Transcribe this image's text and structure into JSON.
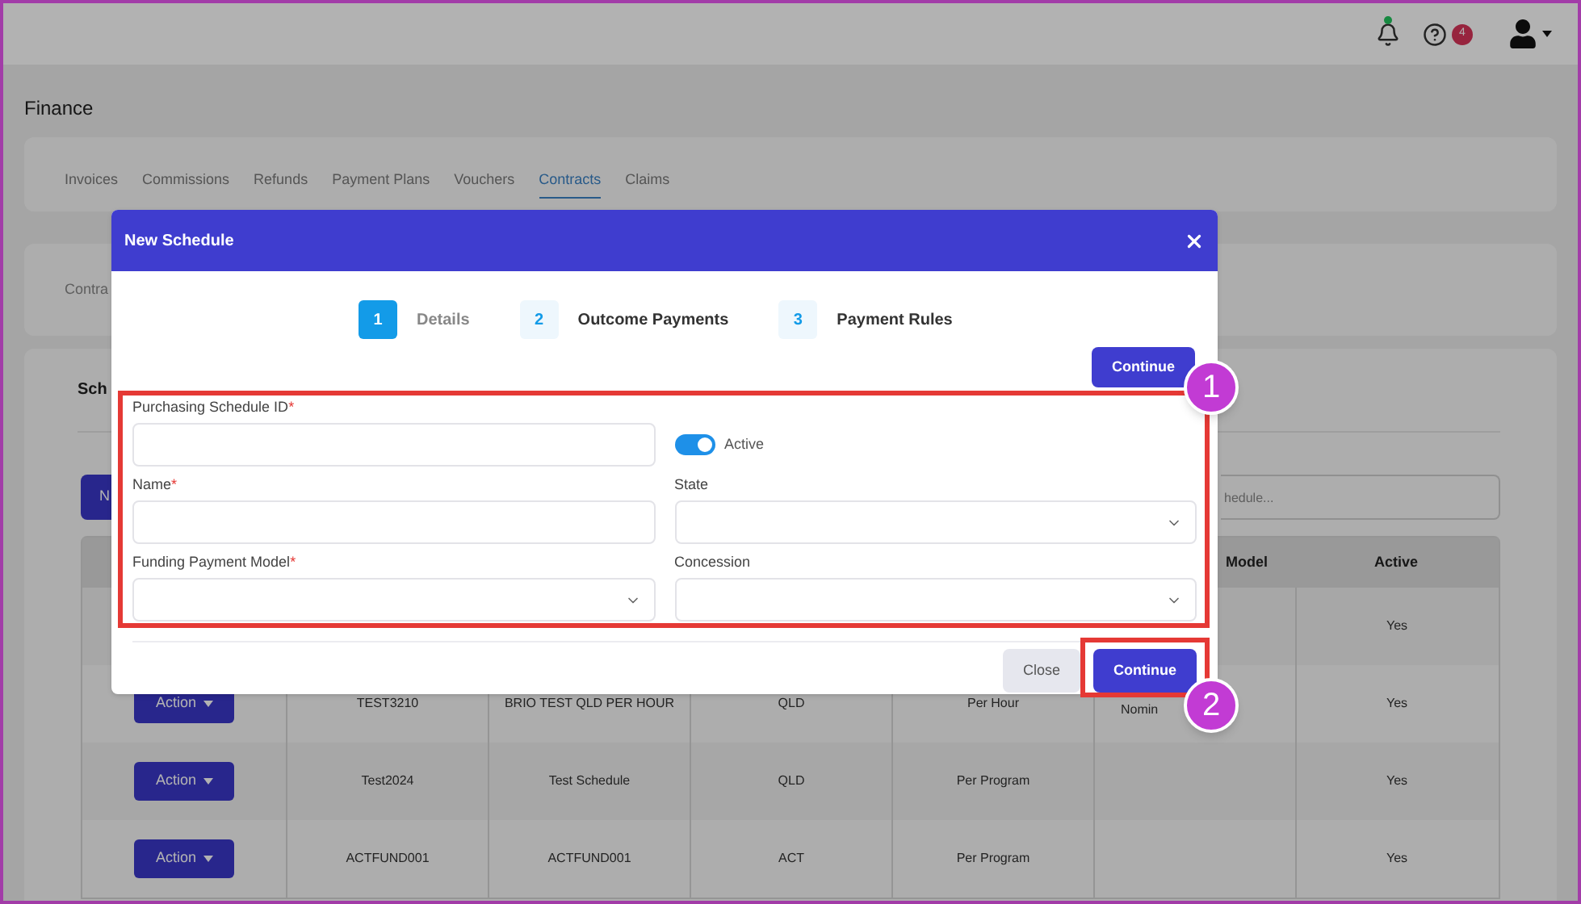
{
  "header": {
    "help_badge": "4"
  },
  "page_title": "Finance",
  "tabs": [
    {
      "label": "Invoices",
      "selected": false
    },
    {
      "label": "Commissions",
      "selected": false
    },
    {
      "label": "Refunds",
      "selected": false
    },
    {
      "label": "Payment Plans",
      "selected": false
    },
    {
      "label": "Vouchers",
      "selected": false
    },
    {
      "label": "Contracts",
      "selected": true
    },
    {
      "label": "Claims",
      "selected": false
    }
  ],
  "contracts_card": {
    "label": "Contra"
  },
  "schedules_card": {
    "title": "Sch",
    "new_button": "N",
    "search": {
      "placeholder": "hedule..."
    },
    "table": {
      "columns": [
        "Model",
        "Active"
      ],
      "rows": [
        {
          "column_7": "Yes"
        },
        {
          "action": "Action",
          "column_2": "TEST3210",
          "column_3": "BRIO TEST QLD PER HOUR",
          "column_4": "QLD",
          "column_5": "Per Hour",
          "column_6": "Nomin",
          "column_7": "Yes"
        },
        {
          "action": "Action",
          "column_2": "Test2024",
          "column_3": "Test Schedule",
          "column_4": "QLD",
          "column_5": "Per Program",
          "column_7": "Yes"
        },
        {
          "action": "Action",
          "column_2": "ACTFUND001",
          "column_3": "ACTFUND001",
          "column_4": "ACT",
          "column_5": "Per Program",
          "column_7": "Yes"
        }
      ]
    }
  },
  "dialog": {
    "title": "New Schedule",
    "steps": [
      {
        "number": "1",
        "label": "Details",
        "selected": true
      },
      {
        "number": "2",
        "label": "Outcome Payments",
        "selected": false
      },
      {
        "number": "3",
        "label": "Payment Rules",
        "selected": false
      }
    ],
    "top_button": "Continue",
    "fields": [
      {
        "kind": "text",
        "label": "Purchasing Schedule ID",
        "required_mark": "*"
      },
      {
        "kind": "toggle",
        "label": "Active",
        "on": true
      },
      {
        "kind": "text",
        "label": "Name",
        "required_mark": "*"
      },
      {
        "kind": "select",
        "label": "State"
      },
      {
        "kind": "select",
        "label": "Funding Payment Model",
        "required_mark": "*"
      },
      {
        "kind": "select",
        "label": "Concession"
      }
    ],
    "footer_buttons": [
      {
        "kind": "secondary",
        "label": "Close"
      },
      {
        "kind": "primary",
        "label": "Continue"
      }
    ]
  },
  "annotations": [
    {
      "number": "1"
    },
    {
      "number": "2"
    }
  ]
}
